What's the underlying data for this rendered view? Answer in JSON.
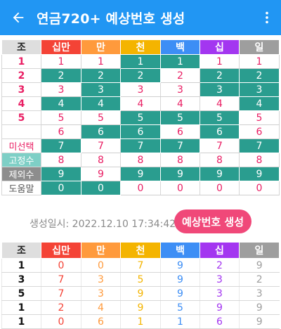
{
  "app": {
    "title": "연금720+ 예상번호 생성",
    "back_icon": "arrow-back-icon",
    "menu_icon": "more-vertical-icon"
  },
  "colors": {
    "appbar": "#2196f3",
    "selected_cell": "#2a9d8f",
    "generate_button": "#f04879",
    "label_pink": "#e91e63",
    "digit_pink": "#e91e63"
  },
  "grid": {
    "headers": [
      {
        "label": "조",
        "color": "#dedede",
        "text_color": "#222222"
      },
      {
        "label": "십만",
        "color": "#f44336"
      },
      {
        "label": "만",
        "color": "#ff9a3c"
      },
      {
        "label": "천",
        "color": "#f4b400"
      },
      {
        "label": "백",
        "color": "#3d8ef5"
      },
      {
        "label": "십",
        "color": "#a336f0"
      },
      {
        "label": "일",
        "color": "#9e9e9e"
      }
    ],
    "rows": [
      {
        "label": "1",
        "cells": [
          "1",
          "1",
          "1",
          "1",
          "1",
          "1"
        ],
        "selected": [
          false,
          false,
          true,
          true,
          false,
          false
        ]
      },
      {
        "label": "2",
        "cells": [
          "2",
          "2",
          "2",
          "2",
          "2",
          "2"
        ],
        "selected": [
          true,
          true,
          true,
          false,
          true,
          true
        ]
      },
      {
        "label": "3",
        "cells": [
          "3",
          "3",
          "3",
          "3",
          "3",
          "3"
        ],
        "selected": [
          false,
          true,
          false,
          false,
          true,
          true
        ]
      },
      {
        "label": "4",
        "cells": [
          "4",
          "4",
          "4",
          "4",
          "4",
          "4"
        ],
        "selected": [
          true,
          true,
          false,
          false,
          false,
          true
        ]
      },
      {
        "label": "5",
        "cells": [
          "5",
          "5",
          "5",
          "5",
          "5",
          "5"
        ],
        "selected": [
          false,
          false,
          true,
          true,
          true,
          false
        ]
      },
      {
        "label": "",
        "cells": [
          "6",
          "6",
          "6",
          "6",
          "6",
          "6"
        ],
        "selected": [
          false,
          true,
          true,
          false,
          true,
          false
        ]
      },
      {
        "label": "미선택",
        "label_style": "light",
        "cells": [
          "7",
          "7",
          "7",
          "7",
          "7",
          "7"
        ],
        "selected": [
          true,
          false,
          true,
          true,
          false,
          true
        ]
      },
      {
        "label": "고정수",
        "label_style": "teal",
        "cells": [
          "8",
          "8",
          "8",
          "8",
          "8",
          "8"
        ],
        "selected": [
          false,
          false,
          false,
          false,
          false,
          false
        ]
      },
      {
        "label": "제외수",
        "label_style": "gray",
        "cells": [
          "9",
          "9",
          "9",
          "9",
          "9",
          "9"
        ],
        "selected": [
          true,
          false,
          true,
          true,
          true,
          true
        ]
      },
      {
        "label": "도움말",
        "label_style": "plain",
        "cells": [
          "0",
          "0",
          "0",
          "0",
          "0",
          "0"
        ],
        "selected": [
          true,
          true,
          false,
          false,
          false,
          false
        ]
      }
    ]
  },
  "generation": {
    "time_label": "생성일시: 2022.12.10  17:34:42",
    "button_label": "예상번호 생성"
  },
  "results": {
    "headers": [
      "조",
      "십만",
      "만",
      "천",
      "백",
      "십",
      "일"
    ],
    "rows": [
      [
        "1",
        "0",
        "0",
        "7",
        "9",
        "2",
        "9"
      ],
      [
        "3",
        "7",
        "3",
        "5",
        "9",
        "3",
        "2"
      ],
      [
        "5",
        "7",
        "3",
        "9",
        "9",
        "3",
        "3"
      ],
      [
        "1",
        "2",
        "4",
        "9",
        "5",
        "9",
        "9"
      ],
      [
        "1",
        "0",
        "6",
        "1",
        "1",
        "6",
        "9"
      ]
    ],
    "digit_colors": [
      "#111111",
      "#f44336",
      "#ff9a3c",
      "#f4b400",
      "#3d8ef5",
      "#a336f0",
      "#9e9e9e"
    ]
  }
}
